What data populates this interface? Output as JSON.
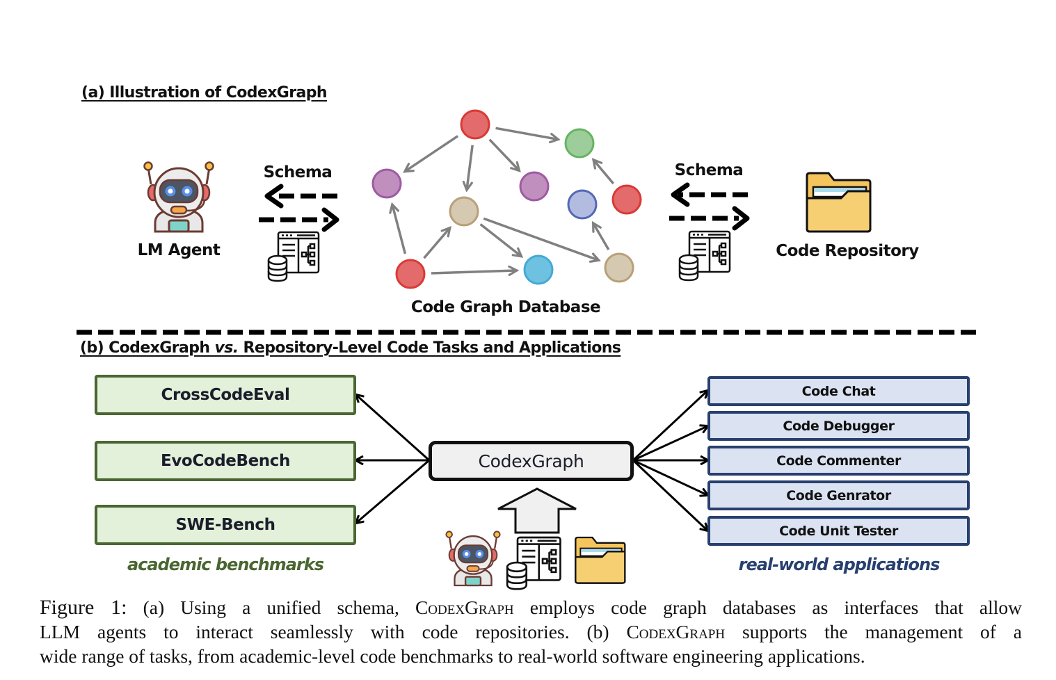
{
  "panel_a": {
    "title": "(a) Illustration of CodexGraph",
    "agent_label": "LM Agent",
    "schema_left_label": "Schema",
    "schema_right_label": "Schema",
    "db_label": "Code Graph Database",
    "repo_label": "Code Repository",
    "graph": {
      "nodes": [
        {
          "id": "n1",
          "color": "red"
        },
        {
          "id": "n2",
          "color": "purple"
        },
        {
          "id": "n3",
          "color": "purple"
        },
        {
          "id": "n4",
          "color": "green"
        },
        {
          "id": "n5",
          "color": "tan"
        },
        {
          "id": "n6",
          "color": "blue"
        },
        {
          "id": "n7",
          "color": "red"
        },
        {
          "id": "n8",
          "color": "red"
        },
        {
          "id": "n9",
          "color": "cyan"
        },
        {
          "id": "n10",
          "color": "tan"
        }
      ],
      "edges": [
        [
          "n1",
          "n2"
        ],
        [
          "n1",
          "n5"
        ],
        [
          "n1",
          "n3"
        ],
        [
          "n1",
          "n4"
        ],
        [
          "n7",
          "n4"
        ],
        [
          "n8",
          "n2"
        ],
        [
          "n8",
          "n5"
        ],
        [
          "n8",
          "n9"
        ],
        [
          "n5",
          "n9"
        ],
        [
          "n5",
          "n10"
        ],
        [
          "n10",
          "n6"
        ]
      ],
      "palette": {
        "red": [
          "#e36b6b",
          "#d93a35"
        ],
        "purple": [
          "#c08fbd",
          "#9e5aa3"
        ],
        "green": [
          "#9ccd9a",
          "#66b462"
        ],
        "tan": [
          "#d6c9b2",
          "#b8a078"
        ],
        "blue": [
          "#b2bce0",
          "#5468b5"
        ],
        "cyan": [
          "#6ec1e0",
          "#45a9d6"
        ]
      },
      "edge_color": "#808080"
    }
  },
  "panel_b": {
    "title_pre": "(b) CodexGraph ",
    "title_vs": "vs.",
    "title_post": " Repository-Level Code Tasks and Applications",
    "center_label": "CodexGraph",
    "benchmarks": [
      "CrossCodeEval",
      "EvoCodeBench",
      "SWE-Bench"
    ],
    "benchmarks_caption": "academic benchmarks",
    "applications": [
      "Code Chat",
      "Code Debugger",
      "Code Commenter",
      "Code Genrator",
      "Code Unit Tester"
    ],
    "applications_caption": "real-world applications",
    "colors": {
      "green_caption": "#4a6631",
      "blue_caption": "#28406e"
    }
  },
  "caption": {
    "fig_label": "Figure 1:",
    "line1_a": " (a) Using a unified schema, ",
    "name1": "CodexGraph",
    "line1_b": " employs code graph databases as interfaces that allow",
    "line2_a": "LLM agents to interact seamlessly with code repositories.  (b) ",
    "name2": "CodexGraph",
    "line2_b": " supports the management of a",
    "line3": "wide range of tasks, from academic-level code benchmarks to real-world software engineering applications."
  }
}
